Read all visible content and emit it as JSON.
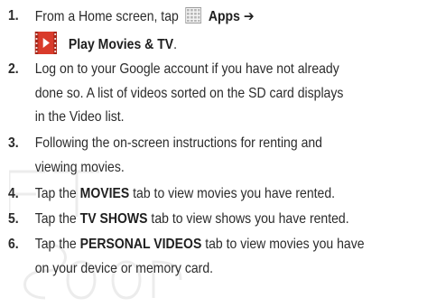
{
  "steps": [
    {
      "number": "1.",
      "line1": {
        "pre": "From a Home screen, tap",
        "bold": "Apps ➔"
      },
      "line2": {
        "bold": "Play Movies & TV",
        "post": "."
      }
    },
    {
      "number": "2.",
      "lines": [
        "Log on to your Google account if you have not already",
        "done so. A list of videos sorted on the SD card displays",
        "in the Video list."
      ]
    },
    {
      "number": "3.",
      "lines": [
        "Following the on-screen instructions for renting and",
        "viewing movies."
      ]
    },
    {
      "number": "4.",
      "pre": "Tap the",
      "bold": "MOVIES",
      "post": "tab to view movies you have rented."
    },
    {
      "number": "5.",
      "pre": "Tap the",
      "bold": "TV SHOWS",
      "post": "tab to view shows you have rented."
    },
    {
      "number": "6.",
      "pre": "Tap the",
      "bold": "PERSONAL VIDEOS",
      "post": "tab to view movies you have",
      "line2": "on your device or memory card."
    }
  ],
  "icons": {
    "apps": "apps-grid-icon",
    "play_movies": "play-movies-tv-icon"
  },
  "colors": {
    "text": "#2b2b2b",
    "icon_red": "#d93b2b",
    "icon_grid": "#9a9a9a"
  }
}
